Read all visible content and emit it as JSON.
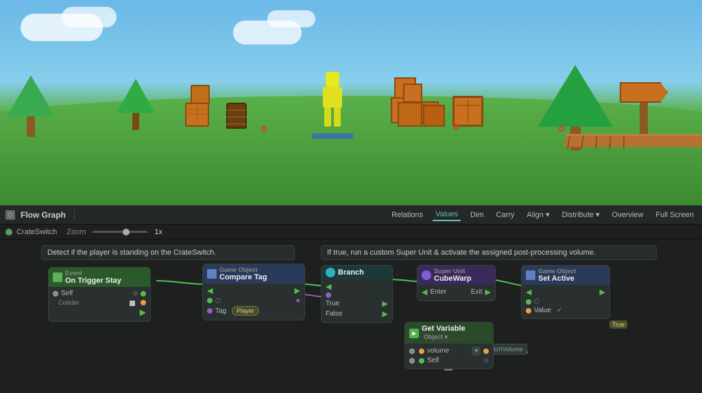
{
  "toolbar": {
    "title": "Flow Graph",
    "buttons": [
      "Relations",
      "Values",
      "Dim",
      "Carry",
      "Align ▾",
      "Distribute ▾",
      "Overview",
      "Full Screen"
    ]
  },
  "breadcrumb": {
    "name": "CrateSwitch",
    "zoom_label": "Zoom",
    "zoom_value": "1x"
  },
  "banners": {
    "left": "Detect if the player is standing on the CrateSwitch.",
    "right": "If true, run a custom Super Unit & activate the assigned post-processing volume."
  },
  "nodes": {
    "on_trigger_stay": {
      "event_label": "Event",
      "title": "On Trigger Stay",
      "port_self": "Self",
      "port_collider": "Collider"
    },
    "compare_tag": {
      "category": "Game Object",
      "title": "Compare Tag",
      "port_tag": "Tag",
      "tag_value": "Player"
    },
    "branch": {
      "title": "Branch",
      "port_true": "True",
      "port_false": "False"
    },
    "super_unit": {
      "category": "Super Unit",
      "title": "CubeWarp",
      "port_enter": "Enter",
      "port_exit": "Exit"
    },
    "set_active": {
      "category": "Game Object",
      "title": "Set Active",
      "port_value": "Value"
    },
    "get_variable": {
      "title": "Get Variable",
      "subtitle": "Object ▾",
      "port_volume": "volume",
      "port_self": "Self"
    }
  }
}
